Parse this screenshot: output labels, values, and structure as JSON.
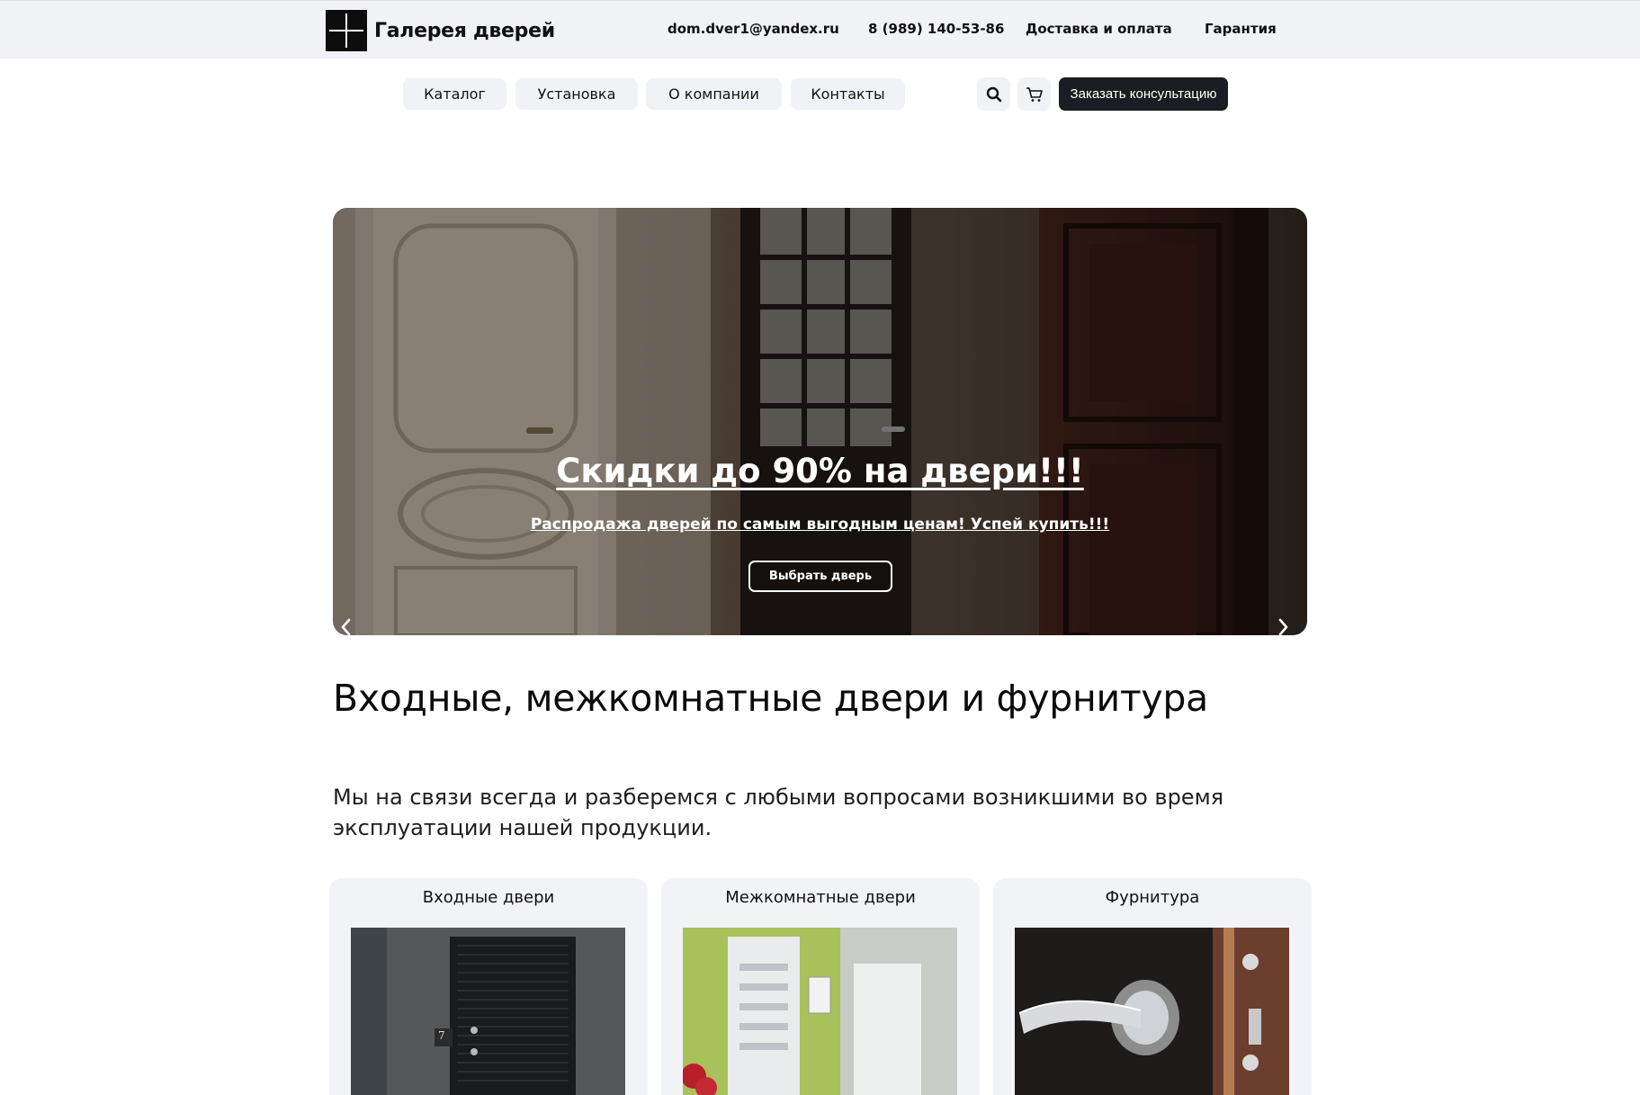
{
  "brand": {
    "name": "Галерея дверей",
    "logo_icon": "door-grid-logo"
  },
  "topbar": {
    "email": "dom.dver1@yandex.ru",
    "phone": "8 (989) 140-53-86",
    "links": [
      "Доставка и оплата",
      "Гарантия"
    ]
  },
  "nav": {
    "items": [
      "Каталог",
      "Установка",
      "О компании",
      "Контакты"
    ],
    "search_icon": "search-icon",
    "cart_icon": "cart-icon",
    "cta_label": "Заказать консультацию"
  },
  "hero": {
    "title": "Скидки до 90% на двери!!!",
    "subtitle": "Распродажа дверей по самым выгодным ценам! Успей купить!!!",
    "button_label": "Выбрать дверь",
    "prev_icon": "chevron-left-icon",
    "next_icon": "chevron-right-icon"
  },
  "intro": {
    "heading": "Входные, межкомнатные двери и фурнитура",
    "text": "Мы на связи всегда и разберемся с любыми вопросами возникшими во время эксплуатации нашей продукции."
  },
  "categories": [
    {
      "title": "Входные двери",
      "badge": "7"
    },
    {
      "title": "Межкомнатные двери"
    },
    {
      "title": "Фурнитура"
    }
  ],
  "colors": {
    "dark": "#1c1d22",
    "light_bg": "#f1f2f5",
    "white": "#ffffff"
  }
}
